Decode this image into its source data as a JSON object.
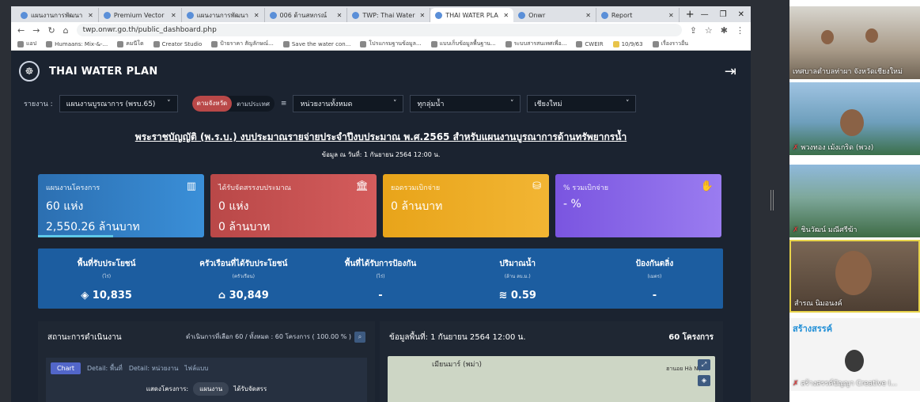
{
  "browser": {
    "tabs": [
      {
        "label": "แผนงานการพัฒนา"
      },
      {
        "label": "Premium Vector"
      },
      {
        "label": "แผนงานการพัฒนา"
      },
      {
        "label": "006 ด้านสหกรณ์"
      },
      {
        "label": "TWP: Thai Water"
      },
      {
        "label": "THAI WATER PLA"
      },
      {
        "label": "Onwr"
      },
      {
        "label": "Report"
      }
    ],
    "url": "twp.onwr.go.th/public_dashboard.php",
    "bookmarks": [
      "แอป",
      "Humaans: Mix-&-...",
      "คมนีโด",
      "Creator Studio",
      "ป้ายราคา สัญลักษณ์...",
      "Save the water con...",
      "โปรแกรมฐานข้อมูล...",
      "แบบเก็บข้อมูลพื้นฐาน...",
      "ระบบสารสนเทศเพื่อ...",
      "CWEIR",
      "10/9/63",
      "เรื่องราวอื่น"
    ]
  },
  "app": {
    "title": "THAI WATER PLAN",
    "filters": {
      "report_label": "รายงาน :",
      "report_value": "แผนงานบูรณาการ (พรบ.65)",
      "toggle_on": "ตามจังหวัด",
      "toggle_off": "ตามประเทศ",
      "agency": "หน่วยงานทั้งหมด",
      "basin": "ทุกลุ่มน้ำ",
      "province": "เชียงใหม่"
    },
    "main_title": "พระราชบัญญัติ (พ.ร.บ.) งบประมาณรายจ่ายประจำปีงบประมาณ พ.ศ.2565 สำหรับแผนงานบูรณาการด้านทรัพยากรน้ำ",
    "subtitle": "ข้อมูล ณ วันที่: 1 กันยายน 2564 12:00 น.",
    "cards": [
      {
        "label": "แผนงานโครงการ",
        "v1": "60 แห่ง",
        "v2": "2,550.26 ล้านบาท",
        "color": "#2c6fb1"
      },
      {
        "label": "ได้รับจัดสรรงบประมาณ",
        "v1": "0 แห่ง",
        "v2": "0 ล้านบาท",
        "color": "#b94848"
      },
      {
        "label": "ยอดรวมเบิกจ่าย",
        "v1": "0 ล้านบาท",
        "v2": "",
        "color": "#e8a41a"
      },
      {
        "label": "% รวมเบิกจ่าย",
        "v1": "- %",
        "v2": "",
        "color": "#7a55e0"
      }
    ],
    "stats": [
      {
        "label": "พื้นที่รับประโยชน์",
        "unit": "(ไร่)",
        "value": "10,835"
      },
      {
        "label": "ครัวเรือนที่ได้รับประโยชน์",
        "unit": "(ครัวเรือน)",
        "value": "30,849"
      },
      {
        "label": "พื้นที่ได้รับการป้องกัน",
        "unit": "(ไร่)",
        "value": "-"
      },
      {
        "label": "ปริมาณน้ำ",
        "unit": "(ล้าน ลบ.ม.)",
        "value": "0.59"
      },
      {
        "label": "ป้องกันตลิ่ง",
        "unit": "(เมตร)",
        "value": "-"
      }
    ],
    "left_panel": {
      "title": "สถานะการดำเนินงาน",
      "info": "ดำเนินการที่เลือก 60 / ทั้งหมด : 60 โครงการ ( 100.00 % )",
      "tabs": [
        "Chart",
        "Detail: พื้นที่",
        "Detail: หน่วยงาน",
        "ไฟล์แบบ"
      ],
      "row_label": "แสดงโครงการ:",
      "pill1": "แผนงาน",
      "pill2": "ได้รับจัดสรร"
    },
    "right_panel": {
      "title": "ข้อมูลพื้นที่: 1 กันยายน 2564 12:00 น.",
      "count": "60 โครงการ",
      "map_label1": "เมียนมาร์ (พม่า)",
      "map_label2": "ฮานอย Hà Nội"
    }
  },
  "participants": [
    {
      "name": "เทศบาลตำบลท่าผา จังหวัดเชียงใหม่"
    },
    {
      "name": "พวงทอง เม้งเกริด (พวง)"
    },
    {
      "name": "ชินวัฒน์ มณีศรีฆ้า"
    },
    {
      "name": "สำรณ นิมอนงค์"
    },
    {
      "name": "สร้างสรรค์ปัญญา Creative I..."
    }
  ]
}
